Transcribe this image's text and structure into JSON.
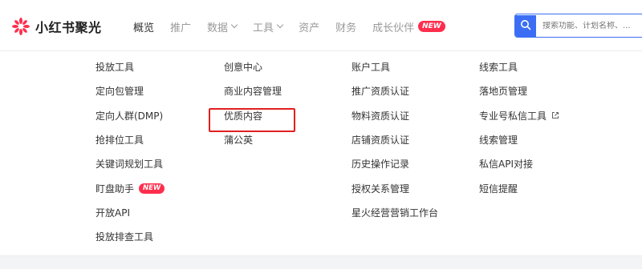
{
  "brand": {
    "name": "小红书聚光",
    "accent": "#ff2e4d"
  },
  "nav": {
    "items": [
      {
        "label": "概览",
        "active": true,
        "dropdown": false
      },
      {
        "label": "推广",
        "active": false,
        "dropdown": false
      },
      {
        "label": "数据",
        "active": false,
        "dropdown": true
      },
      {
        "label": "工具",
        "active": false,
        "dropdown": true
      },
      {
        "label": "资产",
        "active": false,
        "dropdown": false
      },
      {
        "label": "财务",
        "active": false,
        "dropdown": false
      },
      {
        "label": "成长伙伴",
        "active": false,
        "dropdown": false,
        "badge": "NEW"
      }
    ]
  },
  "search": {
    "placeholder": "搜索功能、计划名称、...",
    "icon": "search-icon",
    "color": "#3b6ef5"
  },
  "menu": {
    "columns": [
      {
        "title": "投放工具",
        "items": [
          {
            "label": "定向包管理"
          },
          {
            "label": "定向人群(DMP)"
          },
          {
            "label": "抢排位工具"
          },
          {
            "label": "关键词规划工具"
          },
          {
            "label": "盯盘助手",
            "badge": "NEW"
          },
          {
            "label": "开放API"
          },
          {
            "label": "投放排查工具"
          }
        ]
      },
      {
        "title": "创意中心",
        "items": [
          {
            "label": "商业内容管理"
          },
          {
            "label": "优质内容",
            "highlighted": true
          },
          {
            "label": "蒲公英"
          }
        ]
      },
      {
        "title": "账户工具",
        "items": [
          {
            "label": "推广资质认证"
          },
          {
            "label": "物料资质认证"
          },
          {
            "label": "店铺资质认证"
          },
          {
            "label": "历史操作记录"
          },
          {
            "label": "授权关系管理"
          },
          {
            "label": "星火经营营销工作台"
          }
        ]
      },
      {
        "title": "线索工具",
        "items": [
          {
            "label": "落地页管理"
          },
          {
            "label": "专业号私信工具",
            "external": true
          },
          {
            "label": "线索管理"
          },
          {
            "label": "私信API对接"
          },
          {
            "label": "短信提醒"
          }
        ]
      }
    ]
  }
}
